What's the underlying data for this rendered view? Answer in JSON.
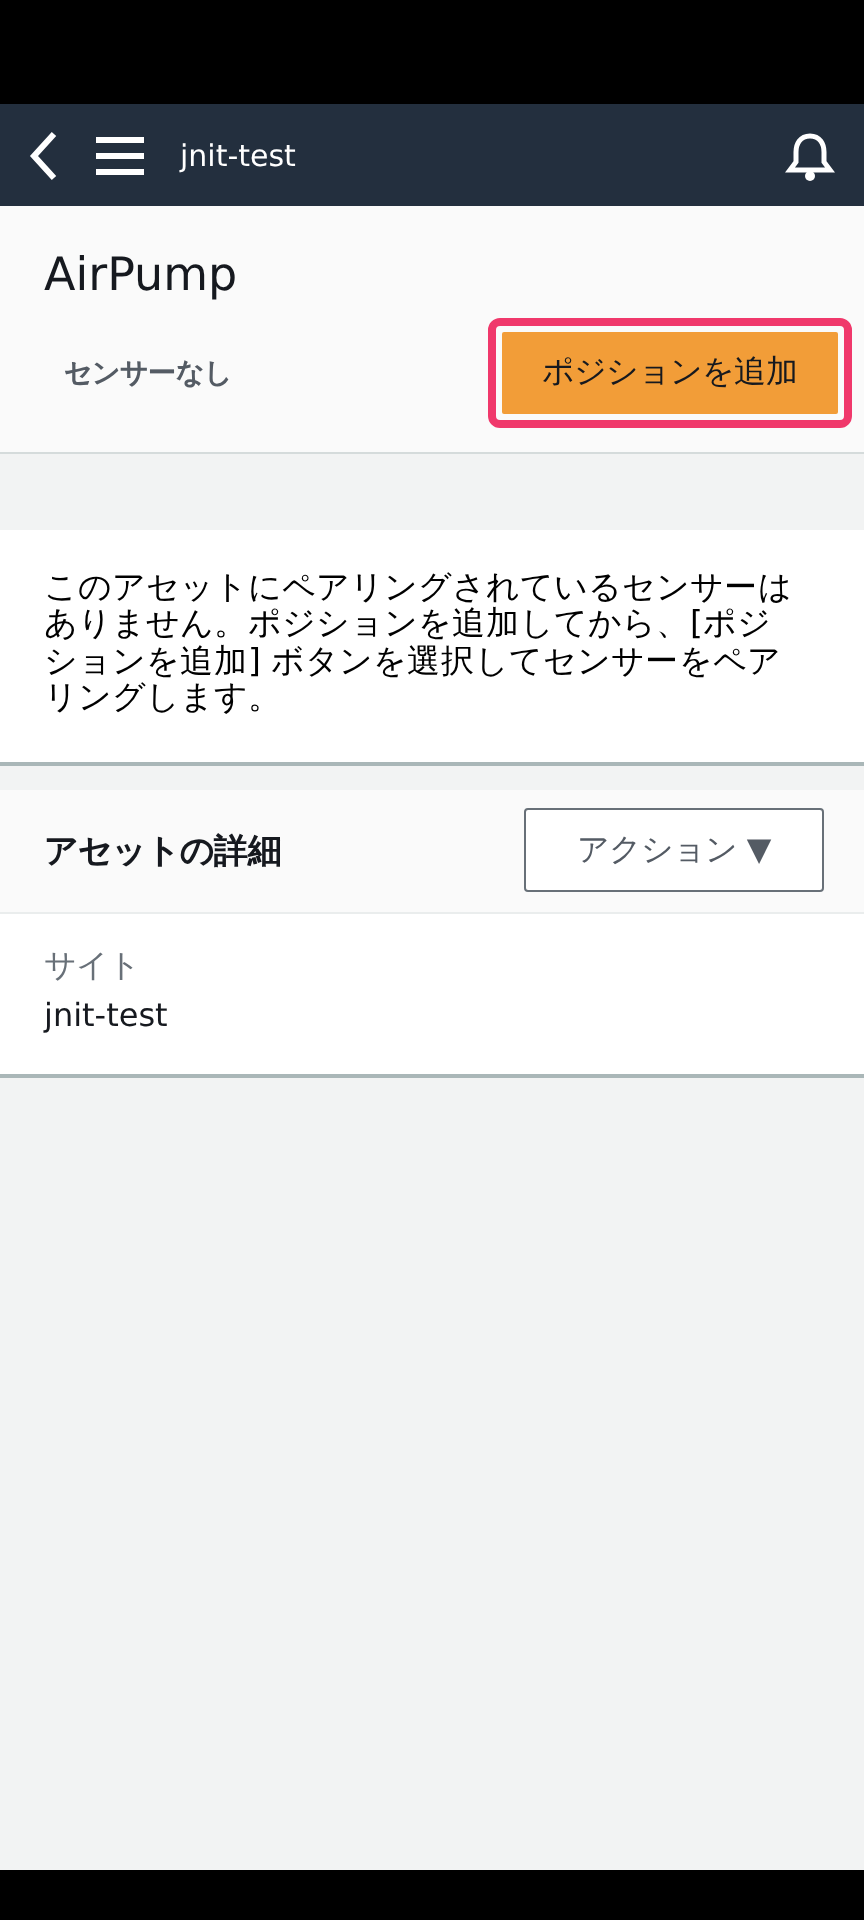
{
  "nav": {
    "title": "jnit-test"
  },
  "header": {
    "title": "AirPump",
    "subtitle": "センサーなし",
    "button": {
      "label": "ポジションを追加",
      "highlighted": true
    }
  },
  "message": "このアセットにペアリングされているセンサーはありません。ポジションを追加してから、[ポジションを追加] ボタンを選択してセンサーをペアリングします。",
  "details": {
    "title": "アセットの詳細",
    "action_button": "アクション ▼",
    "fields": [
      {
        "label": "サイト",
        "value": "jnit-test"
      }
    ]
  }
}
